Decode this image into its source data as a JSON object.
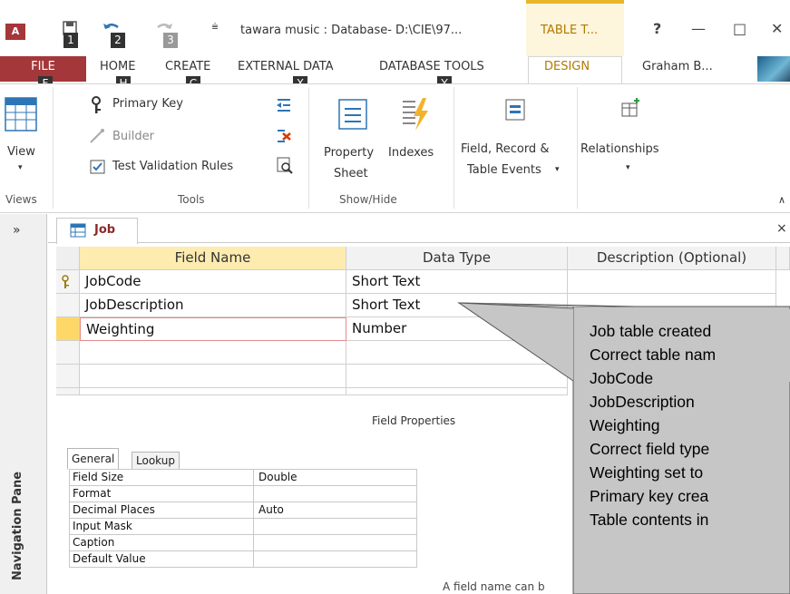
{
  "titlebar": {
    "app_icon": "A",
    "title": "tawara music : Database- D:\\CIE\\97...",
    "context_tab": "TABLE T...",
    "help": "?",
    "minimize": "—",
    "maximize": "□",
    "close": "✕",
    "keytips": [
      "1",
      "2",
      "3"
    ]
  },
  "tabs": {
    "file": "FILE",
    "home": "HOME",
    "create": "CREATE",
    "external": "EXTERNAL DATA",
    "dbtools": "DATABASE TOOLS",
    "design": "DESIGN",
    "user": "Graham B...",
    "keytips": {
      "file": "F",
      "home": "H",
      "create": "C",
      "external": "X",
      "dbtools": "Y"
    }
  },
  "ribbon": {
    "view": "View",
    "primary_key": "Primary Key",
    "builder": "Builder",
    "test_validation": "Test Validation Rules",
    "property_sheet_1": "Property",
    "property_sheet_2": "Sheet",
    "indexes": "Indexes",
    "field_events_1": "Field, Record &",
    "field_events_2": "Table Events",
    "relationships": "Relationships",
    "groups": {
      "views": "Views",
      "tools": "Tools",
      "showhide": "Show/Hide"
    }
  },
  "nav": {
    "chevron": "»",
    "label": "Navigation Pane"
  },
  "doc": {
    "tab_label": "Job",
    "close": "×"
  },
  "grid": {
    "headers": {
      "field_name": "Field Name",
      "data_type": "Data Type",
      "description": "Description (Optional)"
    },
    "rows": [
      {
        "field": "JobCode",
        "type": "Short Text",
        "key": true
      },
      {
        "field": "JobDescription",
        "type": "Short Text",
        "key": false
      },
      {
        "field": "Weighting",
        "type": "Number",
        "key": false
      }
    ]
  },
  "field_properties": {
    "title": "Field Properties",
    "tabs": [
      "General",
      "Lookup"
    ],
    "rows": [
      {
        "k": "Field Size",
        "v": "Double"
      },
      {
        "k": "Format",
        "v": ""
      },
      {
        "k": "Decimal Places",
        "v": "Auto"
      },
      {
        "k": "Input Mask",
        "v": ""
      },
      {
        "k": "Caption",
        "v": ""
      },
      {
        "k": "Default Value",
        "v": ""
      }
    ],
    "help_text": "A field name can b"
  },
  "callout": {
    "lines": [
      "Job table created",
      "Correct table nam",
      "JobCode",
      "JobDescription",
      "Weighting",
      "Correct field type",
      "Weighting set to",
      "Primary key crea",
      "Table contents in"
    ]
  },
  "colors": {
    "file_red": "#a4373a",
    "context_gold": "#e8b52b",
    "callout_gray": "#c6c6c6"
  }
}
